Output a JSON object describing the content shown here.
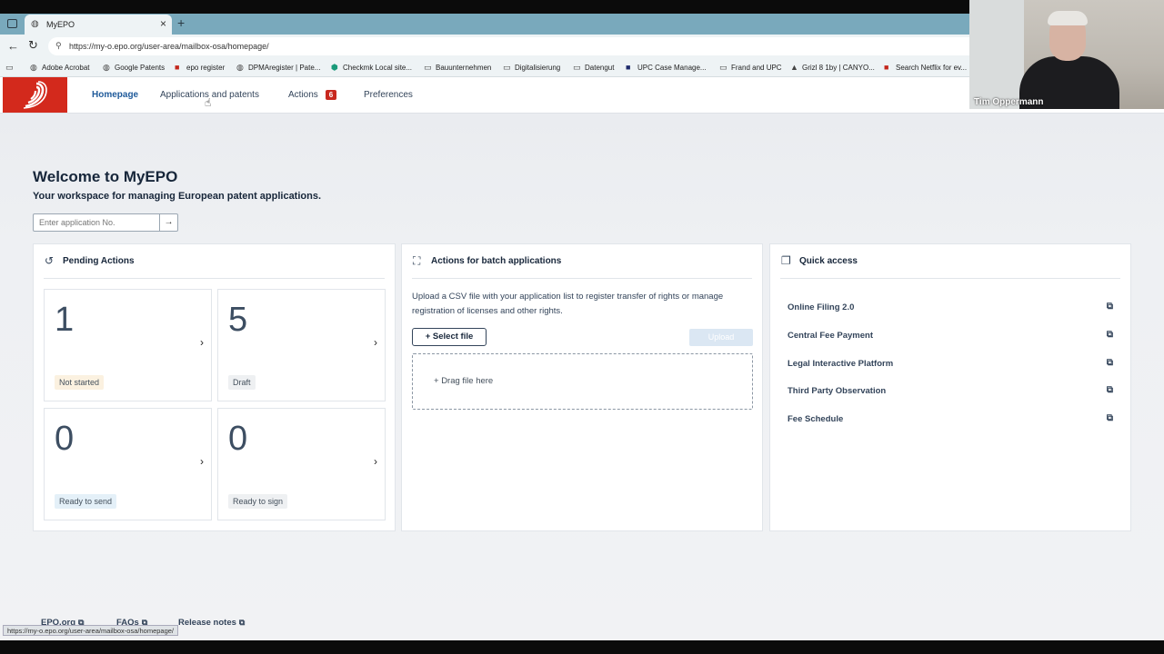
{
  "browser": {
    "tab_title": "MyEPO",
    "new_tab": "+",
    "url": "https://my-o.epo.org/user-area/mailbox-osa/homepage/",
    "bookmarks": [
      {
        "label": "Adobe Acrobat",
        "icon": "globe-icon"
      },
      {
        "label": "Google Patents",
        "icon": "globe-icon"
      },
      {
        "label": "epo register",
        "icon": "epo-icon"
      },
      {
        "label": "DPMAregister | Pate...",
        "icon": "globe-icon"
      },
      {
        "label": "Checkmk Local site...",
        "icon": "checkmk-icon"
      },
      {
        "label": "Bauunternehmen",
        "icon": "folder-icon"
      },
      {
        "label": "Digitalisierung",
        "icon": "folder-icon"
      },
      {
        "label": "Datengut",
        "icon": "folder-icon"
      },
      {
        "label": "UPC Case Manage...",
        "icon": "upc-icon"
      },
      {
        "label": "Frand and UPC",
        "icon": "folder-icon"
      },
      {
        "label": "Grizl 8 1by | CANYO...",
        "icon": "canyon-icon"
      },
      {
        "label": "Search Netflix for ev...",
        "icon": "netflix-icon"
      }
    ],
    "status_url": "https://my-o.epo.org/user-area/mailbox-osa/homepage/"
  },
  "nav": {
    "items": [
      {
        "label": "Homepage",
        "active": true
      },
      {
        "label": "Applications and patents"
      },
      {
        "label": "Actions",
        "badge": "6"
      },
      {
        "label": "Preferences"
      }
    ]
  },
  "hero": {
    "title": "Welcome to MyEPO",
    "subtitle": "Your workspace for managing European patent applications.",
    "search_placeholder": "Enter application No.",
    "search_go": "→"
  },
  "pending": {
    "title": "Pending Actions",
    "tiles": [
      {
        "count": "1",
        "label": "Not started",
        "color": "#fbf1e0"
      },
      {
        "count": "5",
        "label": "Draft",
        "color": "#eef0f2"
      },
      {
        "count": "0",
        "label": "Ready to send",
        "color": "#e4f0f8"
      },
      {
        "count": "0",
        "label": "Ready to sign",
        "color": "#eef0f2"
      }
    ]
  },
  "batch": {
    "title": "Actions for batch applications",
    "description": "Upload a CSV file with your application list to register transfer of rights or manage registration of licenses and other rights.",
    "select_label": "+ Select file",
    "upload_label": "Upload",
    "drop_label": "Drag file here"
  },
  "quick_access": {
    "title": "Quick access",
    "links": [
      "Online Filing 2.0",
      "Central Fee Payment",
      "Legal Interactive Platform",
      "Third Party Observation",
      "Fee Schedule"
    ]
  },
  "footer": {
    "links": [
      "EPO.org",
      "FAQs",
      "Release notes"
    ]
  },
  "webcam": {
    "name": "Tim Oppermann"
  },
  "colors": {
    "brand": "#d3291c",
    "accent": "#1f5a9a",
    "badge": "#c8281e"
  }
}
